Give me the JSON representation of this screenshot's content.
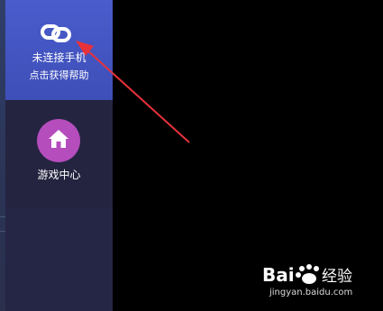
{
  "sidebar": {
    "connect": {
      "title": "未连接手机",
      "subtitle": "点击获得帮助",
      "icon": "link-chain-icon",
      "bg": "#4354c4"
    },
    "game_center": {
      "label": "游戏中心",
      "icon": "home-icon",
      "icon_bg": "#b54dbd"
    }
  },
  "annotation": {
    "arrow_color": "#e8323a"
  },
  "watermark": {
    "brand": "Bai 经验",
    "url": "jingyan.baidu.com"
  }
}
